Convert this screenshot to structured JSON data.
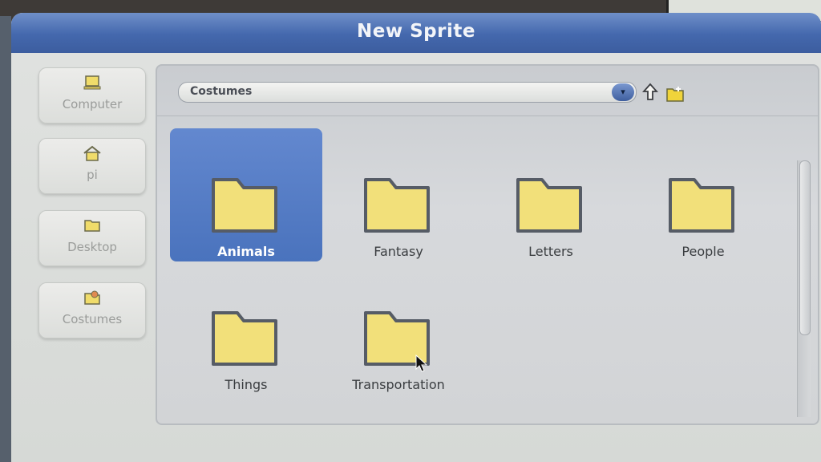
{
  "dialog": {
    "title": "New Sprite"
  },
  "places": [
    {
      "label": "Computer",
      "icon": "computer-icon"
    },
    {
      "label": "pi",
      "icon": "home-icon"
    },
    {
      "label": "Desktop",
      "icon": "folder-icon"
    },
    {
      "label": "Costumes",
      "icon": "costumes-icon"
    }
  ],
  "toolbar": {
    "path": "Costumes",
    "dropdown_glyph": "▾",
    "up_icon": "up-arrow-icon",
    "new_folder_icon": "new-folder-icon"
  },
  "files": [
    {
      "label": "Animals",
      "selected": true
    },
    {
      "label": "Fantasy",
      "selected": false
    },
    {
      "label": "Letters",
      "selected": false
    },
    {
      "label": "People",
      "selected": false
    },
    {
      "label": "Things",
      "selected": false
    },
    {
      "label": "Transportation",
      "selected": false
    }
  ],
  "colors": {
    "titlebar": "#4468ad",
    "selection": "#4a73bd",
    "folder_fill": "#f2e07a",
    "folder_outline": "#565c66"
  }
}
